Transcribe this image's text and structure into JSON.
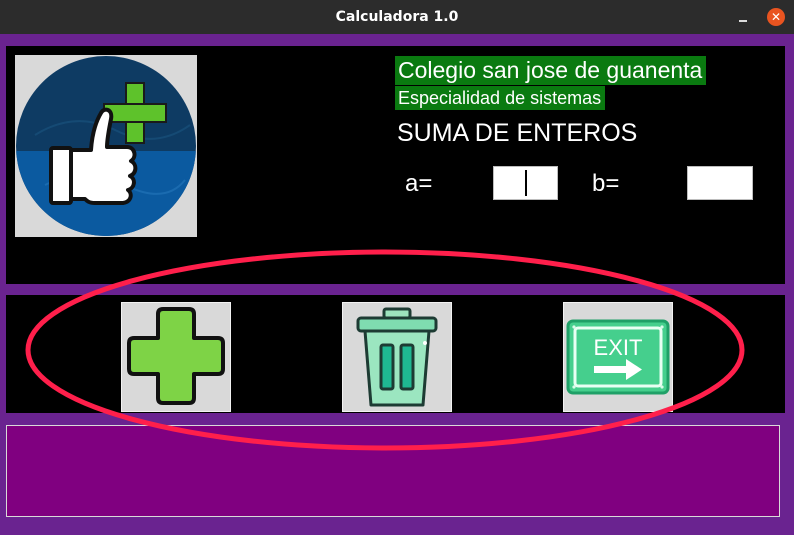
{
  "window": {
    "title": "Calculadora 1.0"
  },
  "header": {
    "school": "Colegio san jose de guanenta",
    "specialty": "Especialidad de sistemas",
    "heading": "SUMA DE ENTEROS"
  },
  "inputs": {
    "a_label": "a=",
    "a_value": "",
    "b_label": "b=",
    "b_value": ""
  },
  "toolbar": {
    "add_icon": "plus-icon",
    "clear_icon": "trash-icon",
    "exit_icon": "exit-sign-icon",
    "exit_text": "EXIT"
  },
  "output": {
    "text": ""
  },
  "colors": {
    "window_bg": "#6a2390",
    "panel_bg": "#000000",
    "label_highlight": "#0a7a10",
    "output_bg": "#800080",
    "annotation": "#ff1f4b"
  }
}
